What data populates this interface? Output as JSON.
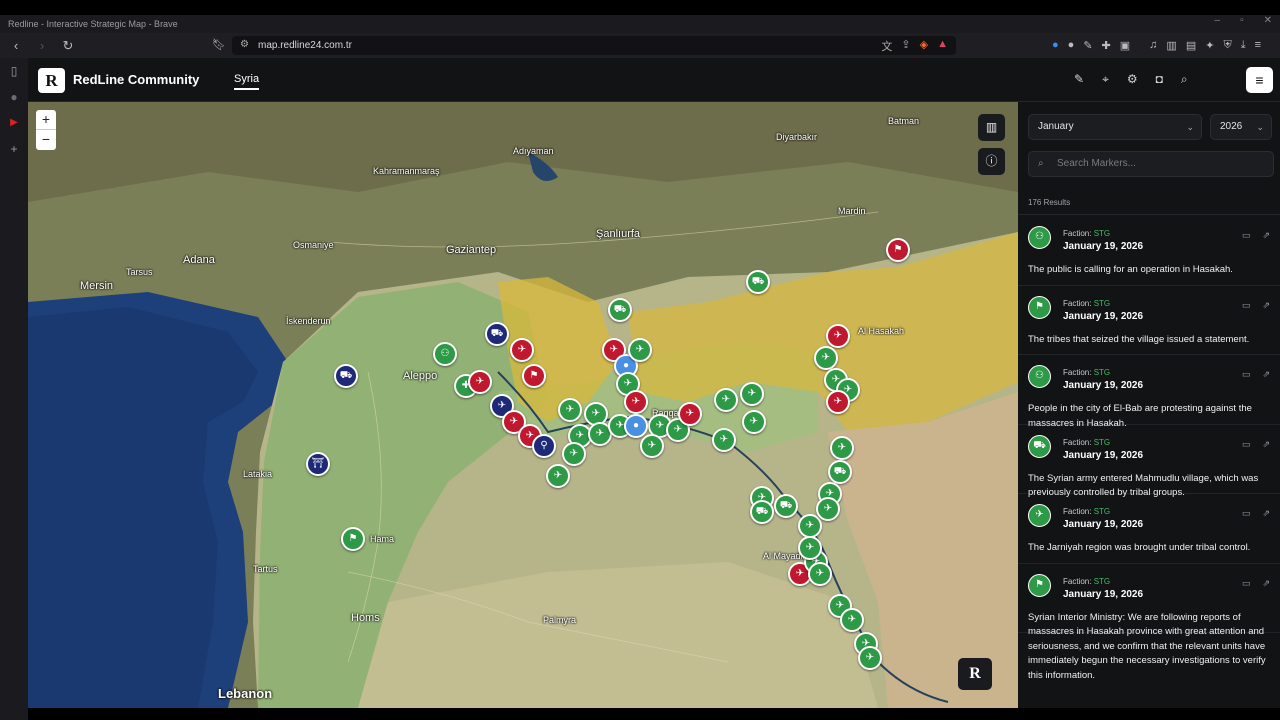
{
  "browser": {
    "window_title": "Redline - Interactive Strategic Map - Brave",
    "url": "map.redline24.com.tr"
  },
  "header": {
    "logo_letter": "R",
    "brand": "RedLine Community",
    "tab": "Syria"
  },
  "map": {
    "zoom_in": "+",
    "zoom_out": "−",
    "badge_letter": "R",
    "places": [
      {
        "name": "Gaziantep",
        "big": true
      },
      {
        "name": "Şanlıurfa",
        "big": true
      },
      {
        "name": "Kahramanmaraş",
        "big": false
      },
      {
        "name": "Adıyaman",
        "big": false
      },
      {
        "name": "Diyarbakır",
        "big": false
      },
      {
        "name": "Batman",
        "big": false
      },
      {
        "name": "Mardin",
        "big": false
      },
      {
        "name": "Adana",
        "big": true
      },
      {
        "name": "Tarsus",
        "big": false
      },
      {
        "name": "Mersin",
        "big": true
      },
      {
        "name": "Osmaniye",
        "big": false
      },
      {
        "name": "İskenderun",
        "big": false
      },
      {
        "name": "Aleppo",
        "big": true
      },
      {
        "name": "Latakia",
        "big": false
      },
      {
        "name": "Tartus",
        "big": false
      },
      {
        "name": "Homs",
        "big": true
      },
      {
        "name": "Hama",
        "big": false
      },
      {
        "name": "Palmyra",
        "big": false
      },
      {
        "name": "Raqqah",
        "big": false
      },
      {
        "name": "Al Hasakah",
        "big": false
      },
      {
        "name": "Al Mayadin",
        "big": false
      },
      {
        "name": "Lebanon",
        "big": true
      }
    ]
  },
  "panel": {
    "month": "January",
    "year": "2026",
    "search_placeholder": "Search Markers...",
    "results": "176 Results",
    "faction_label": "Faction:",
    "items": [
      {
        "faction": "STG",
        "date": "January 19, 2026",
        "text": "The public is calling for an operation in Hasakah."
      },
      {
        "faction": "STG",
        "date": "January 19, 2026",
        "text": "The tribes that seized the village issued a statement."
      },
      {
        "faction": "STG",
        "date": "January 19, 2026",
        "text": "People in the city of El-Bab are protesting against the massacres in Hasakah."
      },
      {
        "faction": "STG",
        "date": "January 19, 2026",
        "text": "The Syrian army entered Mahmudlu village, which was previously controlled by tribal groups."
      },
      {
        "faction": "STG",
        "date": "January 19, 2026",
        "text": "The Jarniyah region was brought under tribal control."
      },
      {
        "faction": "STG",
        "date": "January 19, 2026",
        "text": "Syrian Interior Ministry: We are following reports of massacres in Hasakah province with great attention and seriousness, and we confirm that the relevant units have immediately begun the necessary investigations to verify this information."
      }
    ]
  },
  "colors": {
    "government_green": "#2e9a48",
    "sdf_yellow": "#d8b83a",
    "red_marker": "#c0182e",
    "navy_marker": "#1e2a78",
    "blue_marker": "#4a90e2"
  }
}
